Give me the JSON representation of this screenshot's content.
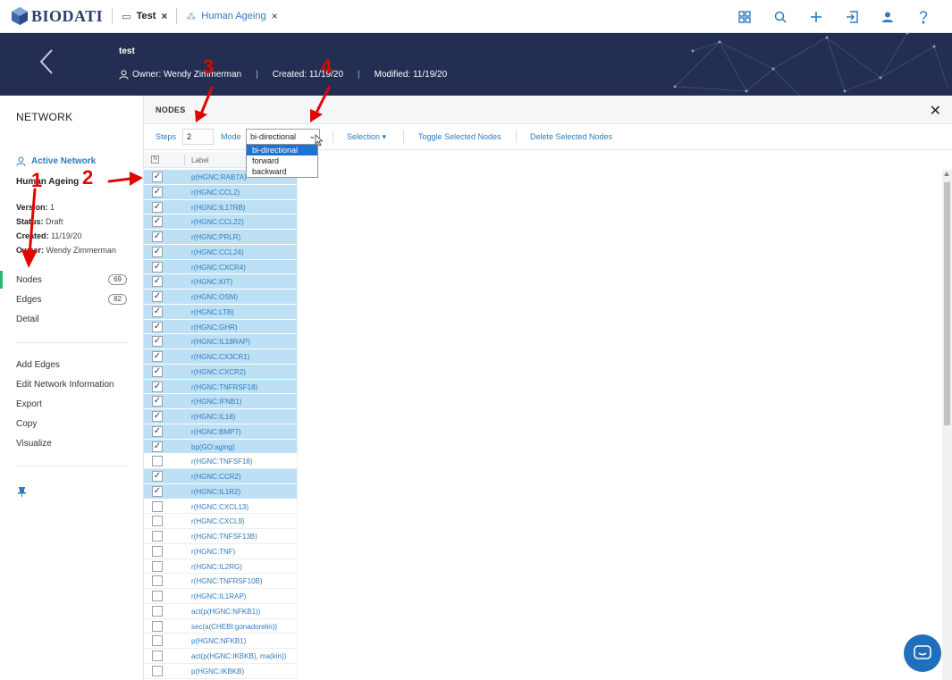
{
  "topbar": {
    "logo_text": "BIODATI",
    "tabs": [
      {
        "label": "Test",
        "icon": "window-icon"
      },
      {
        "label": "Human Ageing",
        "icon": "network-icon"
      }
    ],
    "close_glyph": "×",
    "icons": [
      "grid-icon",
      "search-icon",
      "plus-icon",
      "import-icon",
      "user-icon",
      "help-icon"
    ]
  },
  "banner": {
    "title": "test",
    "owner": "Owner: Wendy Zimmerman",
    "created": "Created: 11/19/20",
    "modified": "Modified: 11/19/20",
    "separator": "|"
  },
  "sidebar": {
    "title": "NETWORK",
    "active_label": "Active Network",
    "network_name": "Human Ageing",
    "version_label": "Version:",
    "version_value": "1",
    "status_label": "Status:",
    "status_value": "Draft",
    "created_label": "Created:",
    "created_value": "11/19/20",
    "owner_label": "Owner:",
    "owner_value": "Wendy Zimmerman",
    "nav": [
      {
        "label": "Nodes",
        "count": "69"
      },
      {
        "label": "Edges",
        "count": "82"
      },
      {
        "label": "Detail"
      }
    ],
    "actions": [
      "Add Edges",
      "Edit Network Information",
      "Export",
      "Copy",
      "Visualize"
    ]
  },
  "panel": {
    "title": "NODES",
    "close": "✕",
    "steps_label": "Steps",
    "steps_value": "2",
    "mode_label": "Mode",
    "mode_value": "bi-directional",
    "selection_label": "Selection",
    "toggle_label": "Toggle Selected Nodes",
    "delete_label": "Delete Selected Nodes",
    "mode_options": [
      "bi-directional",
      "forward",
      "backward"
    ],
    "column_label": "Label",
    "rows": [
      {
        "label": "p(HGNC:RAB7A)",
        "checked": true
      },
      {
        "label": "r(HGNC:CCL2)",
        "checked": true
      },
      {
        "label": "r(HGNC:IL17RB)",
        "checked": true
      },
      {
        "label": "r(HGNC:CCL22)",
        "checked": true
      },
      {
        "label": "r(HGNC:PRLR)",
        "checked": true
      },
      {
        "label": "r(HGNC:CCL24)",
        "checked": true
      },
      {
        "label": "r(HGNC:CXCR4)",
        "checked": true
      },
      {
        "label": "r(HGNC:KIT)",
        "checked": true
      },
      {
        "label": "r(HGNC:OSM)",
        "checked": true
      },
      {
        "label": "r(HGNC:LTB)",
        "checked": true
      },
      {
        "label": "r(HGNC:GHR)",
        "checked": true
      },
      {
        "label": "r(HGNC:IL18RAP)",
        "checked": true
      },
      {
        "label": "r(HGNC:CX3CR1)",
        "checked": true
      },
      {
        "label": "r(HGNC:CXCR2)",
        "checked": true
      },
      {
        "label": "r(HGNC:TNFRSF18)",
        "checked": true
      },
      {
        "label": "r(HGNC:IFNB1)",
        "checked": true
      },
      {
        "label": "r(HGNC:IL18)",
        "checked": true
      },
      {
        "label": "r(HGNC:BMP7)",
        "checked": true
      },
      {
        "label": "bp(GO:aging)",
        "checked": true
      },
      {
        "label": "r(HGNC:TNFSF18)",
        "checked": false
      },
      {
        "label": "r(HGNC:CCR2)",
        "checked": true
      },
      {
        "label": "r(HGNC:IL1R2)",
        "checked": true
      },
      {
        "label": "r(HGNC:CXCL13)",
        "checked": false
      },
      {
        "label": "r(HGNC:CXCL9)",
        "checked": false
      },
      {
        "label": "r(HGNC:TNFSF13B)",
        "checked": false
      },
      {
        "label": "r(HGNC:TNF)",
        "checked": false
      },
      {
        "label": "r(HGNC:IL2RG)",
        "checked": false
      },
      {
        "label": "r(HGNC:TNFRSF10B)",
        "checked": false
      },
      {
        "label": "r(HGNC:IL1RAP)",
        "checked": false
      },
      {
        "label": "act(p(HGNC:NFKB1))",
        "checked": false
      },
      {
        "label": "sec(a(CHEBI:gonadorelin))",
        "checked": false
      },
      {
        "label": "p(HGNC:NFKB1)",
        "checked": false
      },
      {
        "label": "act(p(HGNC:IKBKB), ma(kin))",
        "checked": false
      },
      {
        "label": "p(HGNC:IKBKB)",
        "checked": false
      }
    ]
  },
  "annotations": [
    "1",
    "2",
    "3",
    "4"
  ],
  "colors": {
    "accent": "#2e7bbf",
    "banner": "#232e52",
    "selected_row": "#bde0f5",
    "annotation": "#e10600",
    "active_nav": "#2bb673"
  }
}
